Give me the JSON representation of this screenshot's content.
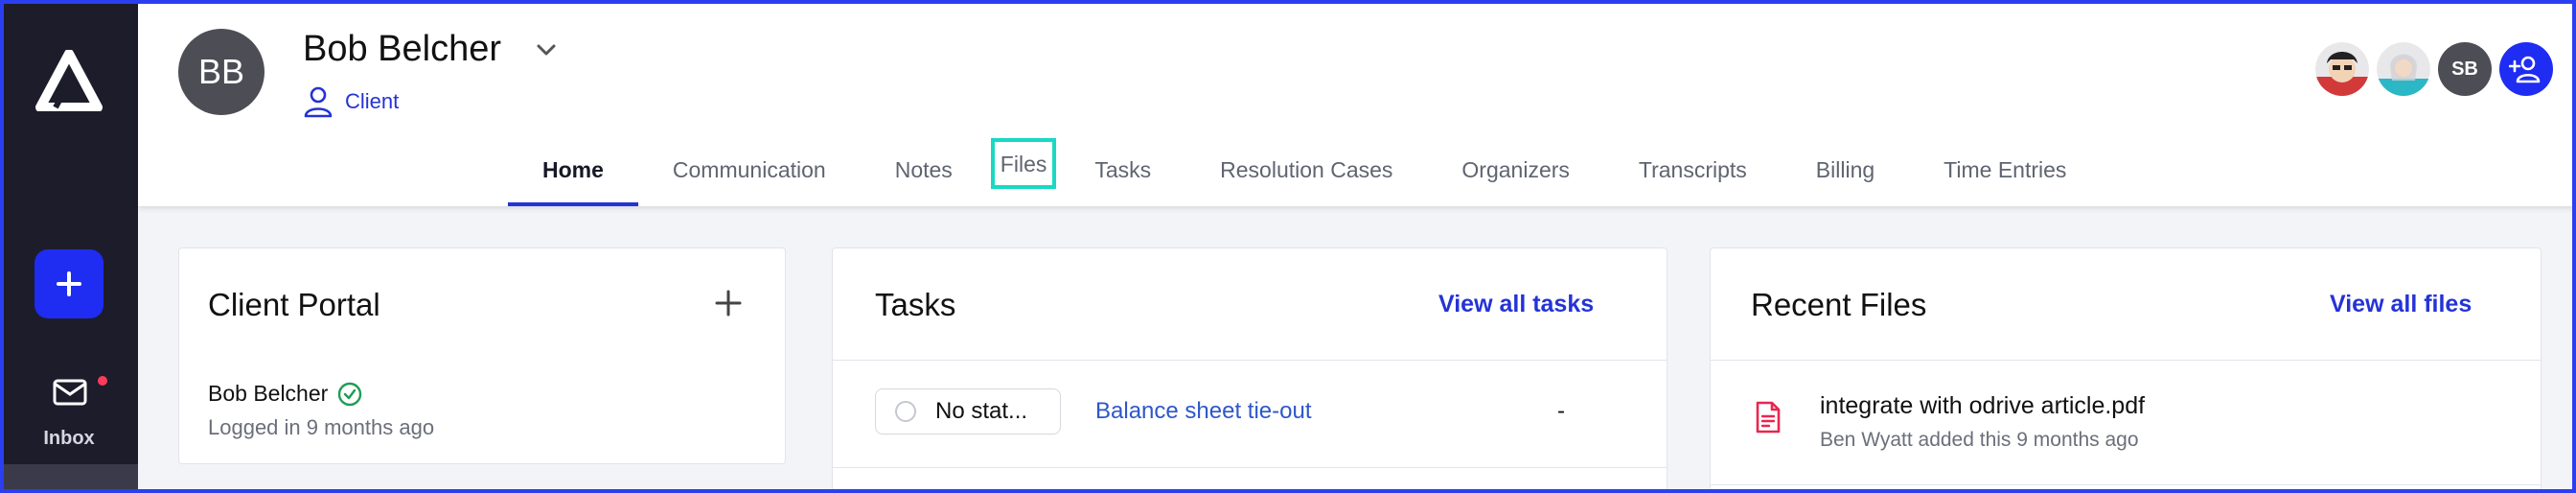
{
  "sidebar": {
    "new_label": "+",
    "inbox_label": "Inbox"
  },
  "client": {
    "initials": "BB",
    "name": "Bob Belcher",
    "type": "Client"
  },
  "team": {
    "sb_initials": "SB"
  },
  "tabs": [
    {
      "label": "Home"
    },
    {
      "label": "Communication"
    },
    {
      "label": "Notes"
    },
    {
      "label": "Files"
    },
    {
      "label": "Tasks"
    },
    {
      "label": "Resolution Cases"
    },
    {
      "label": "Organizers"
    },
    {
      "label": "Transcripts"
    },
    {
      "label": "Billing"
    },
    {
      "label": "Time Entries"
    }
  ],
  "portal": {
    "title": "Client Portal",
    "user_name": "Bob Belcher",
    "last_login": "Logged in 9 months ago"
  },
  "tasks": {
    "title": "Tasks",
    "view_all": "View all tasks",
    "row": {
      "status": "No stat...",
      "name": "Balance sheet tie-out",
      "due": "-"
    }
  },
  "files": {
    "title": "Recent Files",
    "view_all": "View all files",
    "item": {
      "name": "integrate with odrive article.pdf",
      "meta": "Ben Wyatt added this 9 months ago"
    }
  },
  "colors": {
    "accent": "#1f2cf2",
    "sidebar_bg": "#1d1c2b",
    "highlight": "#19d9c3",
    "verified": "#1f9d55",
    "file_icon": "#e8264f"
  }
}
